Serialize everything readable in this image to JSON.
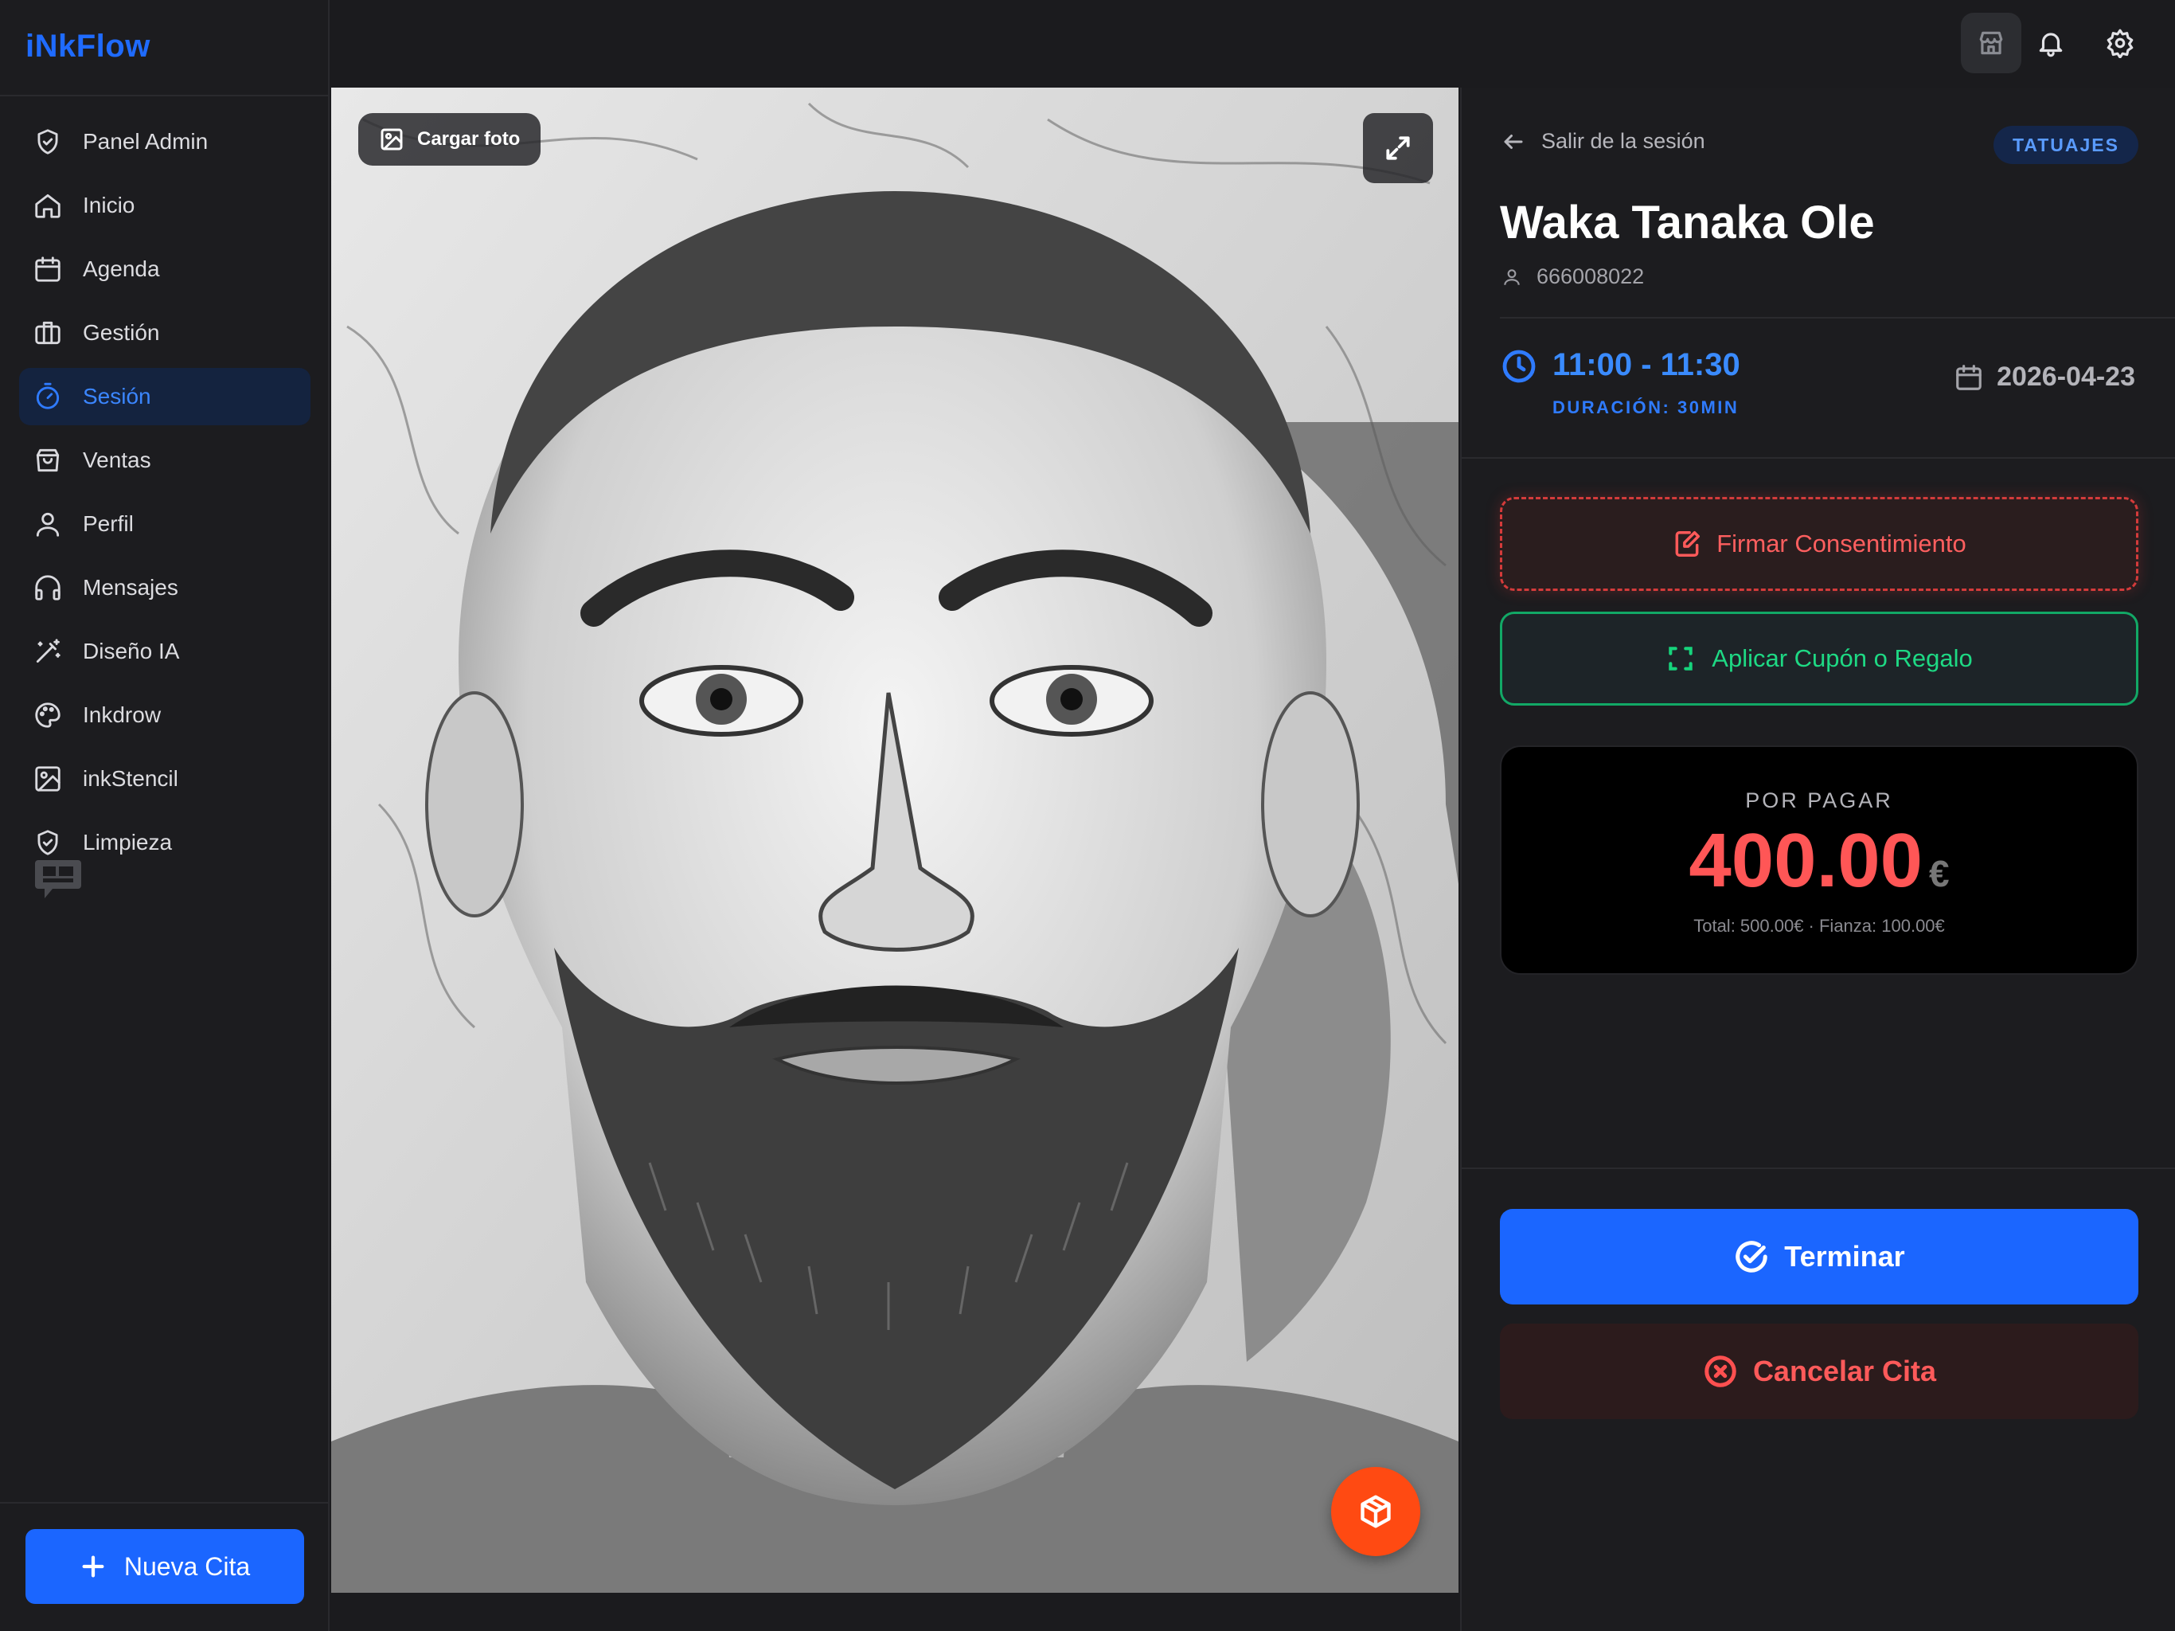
{
  "app": {
    "logo": "iNkFlow"
  },
  "sidebar": {
    "items": [
      {
        "label": "Panel Admin",
        "icon": "shield-check-icon"
      },
      {
        "label": "Inicio",
        "icon": "home-icon"
      },
      {
        "label": "Agenda",
        "icon": "calendar-icon"
      },
      {
        "label": "Gestión",
        "icon": "briefcase-icon"
      },
      {
        "label": "Sesión",
        "icon": "timer-icon",
        "active": true
      },
      {
        "label": "Ventas",
        "icon": "shopping-bag-icon"
      },
      {
        "label": "Perfil",
        "icon": "user-icon"
      },
      {
        "label": "Mensajes",
        "icon": "headphones-icon"
      },
      {
        "label": "Diseño IA",
        "icon": "magic-wand-icon"
      },
      {
        "label": "Inkdrow",
        "icon": "palette-icon"
      },
      {
        "label": "inkStencil",
        "icon": "image-icon"
      },
      {
        "label": "Limpieza",
        "icon": "shield-check-icon"
      }
    ],
    "new_button": "Nueva Cita"
  },
  "topbar": {
    "icons": [
      "store-icon",
      "bell-icon",
      "gear-icon"
    ]
  },
  "photo": {
    "upload_label": "Cargar foto"
  },
  "session": {
    "back_label": "Salir de la sesión",
    "tag": "TATUAJES",
    "client_name": "Waka Tanaka Ole",
    "client_phone": "666008022",
    "time_range": "11:00 - 11:30",
    "duration": "DURACIÓN: 30MIN",
    "date": "2026-04-23",
    "consent_label": "Firmar Consentimiento",
    "coupon_label": "Aplicar Cupón o Regalo",
    "payment": {
      "label": "POR PAGAR",
      "amount": "400.00",
      "currency": "€",
      "detail": "Total: 500.00€ · Fianza: 100.00€"
    },
    "finish_label": "Terminar",
    "cancel_label": "Cancelar Cita"
  },
  "colors": {
    "accent": "#1b66ff",
    "danger": "#ff5656",
    "success": "#16d47c",
    "fab": "#ff4a12"
  }
}
